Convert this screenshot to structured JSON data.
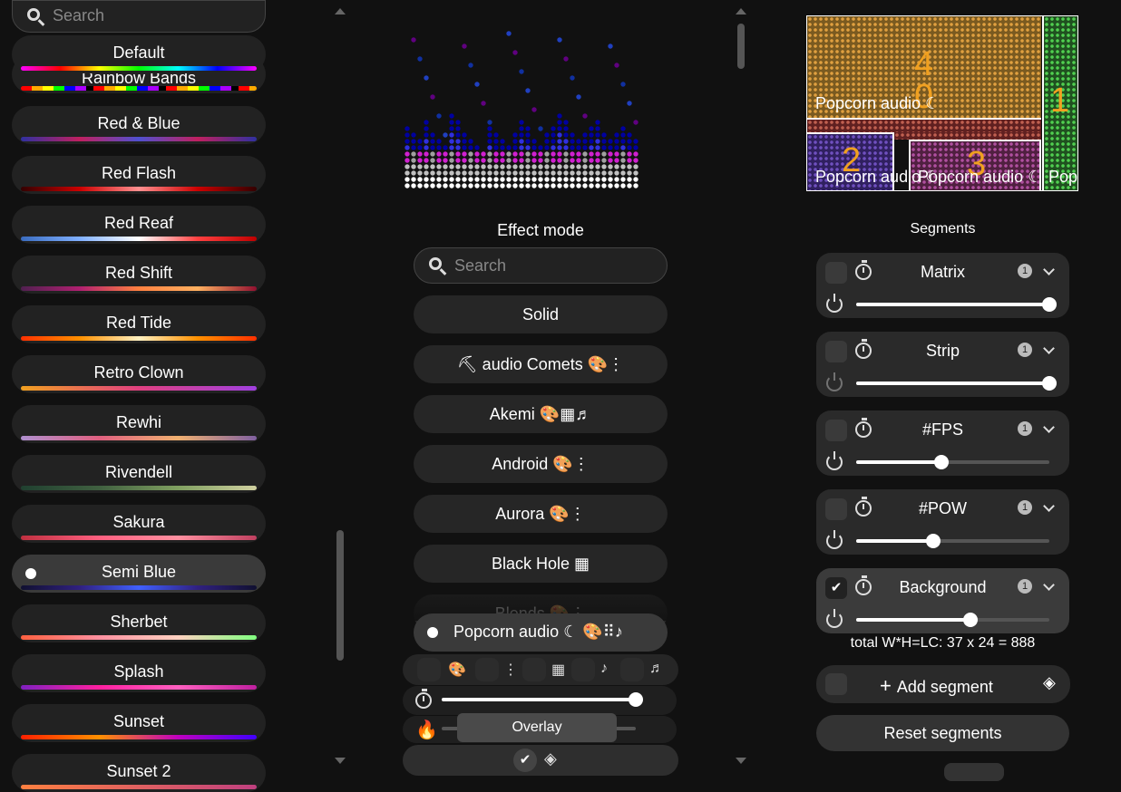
{
  "palettes": {
    "search_placeholder": "Search",
    "items": [
      {
        "label": "Default",
        "gradient": "linear-gradient(90deg,#ff00ff,#ff0000,#ffff00,#00ff00,#00ffff,#0000ff,#ff00ff)"
      },
      {
        "label": "Rainbow Bands",
        "gradient": "repeating-linear-gradient(90deg,#ff0000 0 12px,#ffaa00 12px 24px,#ffff00 24px 36px,#00ff00 36px 48px,#0000ff 48px 60px,#aa00ff 60px 72px,#000 72px 80px)"
      },
      {
        "label": "Red & Blue",
        "gradient": "linear-gradient(90deg,#3030a0,#c02060,#5050d0,#c02060,#3030a0)"
      },
      {
        "label": "Red Flash",
        "gradient": "linear-gradient(90deg,#300,#c00,#ff9090,#c00,#300)"
      },
      {
        "label": "Red Reaf",
        "gradient": "linear-gradient(90deg,#3a6cc0,#80b0ff,#ffffff,#ff4040,#c00000)"
      },
      {
        "label": "Red Shift",
        "gradient": "linear-gradient(90deg,#502050,#b02070,#ff8040,#ffb060,#901030)"
      },
      {
        "label": "Red Tide",
        "gradient": "linear-gradient(90deg,#ff3000,#ff9000,#fff0c0,#ff9000,#ff3000)"
      },
      {
        "label": "Retro Clown",
        "gradient": "linear-gradient(90deg,#f0a020,#e04080,#a040e0)"
      },
      {
        "label": "Rewhi",
        "gradient": "linear-gradient(90deg,#b090d0,#e06080,#f0b070,#8060a0)"
      },
      {
        "label": "Rivendell",
        "gradient": "linear-gradient(90deg,#204030,#406040,#80a060,#d0d0a0)"
      },
      {
        "label": "Sakura",
        "gradient": "linear-gradient(90deg,#c03040,#ff6080,#ff90a0,#c04060)"
      },
      {
        "label": "Semi Blue",
        "gradient": "linear-gradient(90deg,#101030,#302080,#4060ff,#302080,#101030)"
      },
      {
        "label": "Sherbet",
        "gradient": "linear-gradient(90deg,#ff6040,#ff90a0,#ffd0c0,#80ff80)"
      },
      {
        "label": "Splash",
        "gradient": "linear-gradient(90deg,#8020c0,#ff20a0,#ff60c0,#c020a0)"
      },
      {
        "label": "Sunset",
        "gradient": "linear-gradient(90deg,#ff2000,#ff9000,#c000c0,#4000ff)"
      },
      {
        "label": "Sunset 2",
        "gradient": "linear-gradient(90deg,#ff8040,#c04080)"
      }
    ]
  },
  "effects": {
    "title": "Effect mode",
    "search_placeholder": "Search",
    "items": [
      {
        "label": "Solid"
      },
      {
        "label": "⛏ audio Comets 🎨⋮"
      },
      {
        "label": "Akemi 🎨▦♬"
      },
      {
        "label": "Android 🎨⋮"
      },
      {
        "label": "Aurora 🎨⋮"
      },
      {
        "label": "Black Hole ▦"
      },
      {
        "label": "Blends 🎨⋮"
      }
    ],
    "selected_label": "Popcorn audio ☾ 🎨⠿♪",
    "tooltip": "Overlay"
  },
  "preview": {
    "segment_labels": [
      "Popcorn audio ☾",
      "Popcorn audio ☾",
      "Popcorn audio ☾",
      "Pop"
    ],
    "segment_numbers": [
      "4",
      "0",
      "1",
      "2",
      "3"
    ]
  },
  "segments": {
    "title": "Segments",
    "items": [
      {
        "name": "Matrix",
        "info": "1",
        "brightness": 1.0,
        "checked": false
      },
      {
        "name": "Strip",
        "info": "1",
        "brightness": 1.0,
        "checked": false
      },
      {
        "name": "#FPS",
        "info": "1",
        "brightness": 0.44,
        "checked": false
      },
      {
        "name": "#POW",
        "info": "1",
        "brightness": 0.4,
        "checked": false
      },
      {
        "name": "Background",
        "info": "1",
        "brightness": 0.59,
        "checked": true
      }
    ],
    "total": "total W*H=LC: 37 x 24 = 888",
    "add_label": "Add segment",
    "reset_label": "Reset segments"
  },
  "colors": {
    "bg": "#111111",
    "panel": "#262626",
    "accent_orange": "#f0a020"
  }
}
